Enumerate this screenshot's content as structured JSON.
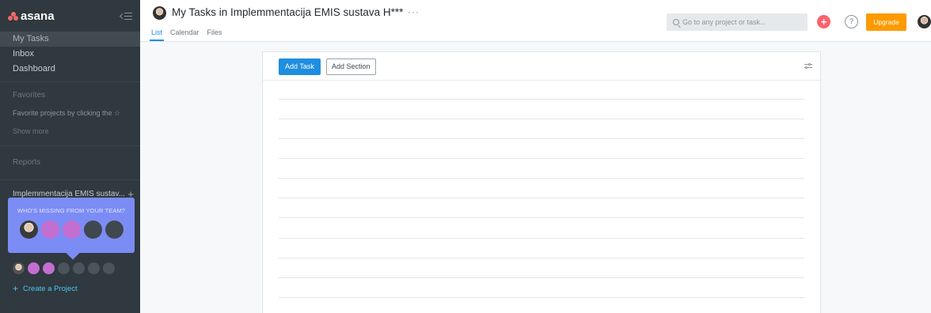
{
  "sidebar": {
    "logo_text": "asana",
    "nav": [
      {
        "label": "My Tasks",
        "active": true
      },
      {
        "label": "Inbox",
        "active": false
      },
      {
        "label": "Dashboard",
        "active": false
      }
    ],
    "favorites_title": "Favorites",
    "favorites_hint": "Favorite projects by clicking the ☆",
    "show_more": "Show more",
    "reports": "Reports",
    "team_name": "Implemmentacija EMIS sustav...",
    "team_plus": "+",
    "invite_text": "WHO'S MISSING FROM YOUR TEAM?",
    "create_project": "Create a Project",
    "create_plus": "+"
  },
  "header": {
    "title": "My Tasks in Implemmentacija EMIS sustava H***",
    "more": "···",
    "tabs": [
      "List",
      "Calendar",
      "Files"
    ],
    "active_tab": "List",
    "search_placeholder": "Go to any project or task...",
    "quick_add": "+",
    "help": "?",
    "upgrade": "Upgrade"
  },
  "main": {
    "add_task": "Add Task",
    "add_section": "Add Section"
  },
  "colors": {
    "sidebar_bg": "#30393f",
    "accent_blue": "#1f8ee0",
    "upgrade_orange": "#fd9a00",
    "quick_add_red": "#fc636b",
    "invite_card": "#7c8cf5"
  }
}
